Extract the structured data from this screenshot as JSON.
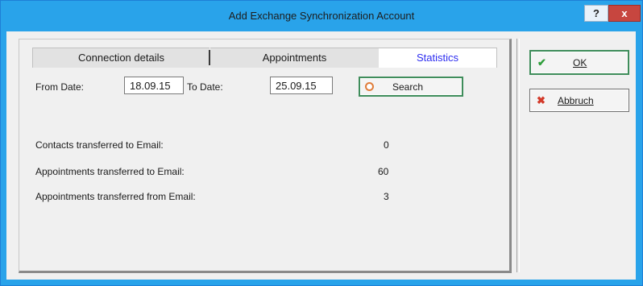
{
  "window": {
    "title": "Add Exchange Synchronization Account",
    "help_label": "?",
    "close_label": "x"
  },
  "tabs": [
    {
      "label": "Connection details",
      "active": false
    },
    {
      "label": "Appointments",
      "active": false
    },
    {
      "label": "Statistics",
      "active": true
    }
  ],
  "filter": {
    "from_label": "From Date:",
    "from_value": "18.09.15",
    "to_label": "To Date:",
    "to_value": "25.09.15",
    "search_label": "Search",
    "search_icon": "search-icon"
  },
  "stats": [
    {
      "label": "Contacts transferred to Email:",
      "value": "0"
    },
    {
      "label": "Appointments transferred to Email:",
      "value": "60"
    },
    {
      "label": "Appointments transferred from Email:",
      "value": "3"
    }
  ],
  "actions": {
    "ok_label": "OK",
    "ok_icon": "check-icon",
    "cancel_label": "Abbruch",
    "cancel_icon": "cross-icon"
  },
  "colors": {
    "title_bar": "#29a3ea",
    "active_tab_text": "#2d2df0",
    "close_button": "#c7463f",
    "check": "#2e9e3a",
    "cross": "#d33a2a",
    "search_ring": "#e07d3a"
  }
}
